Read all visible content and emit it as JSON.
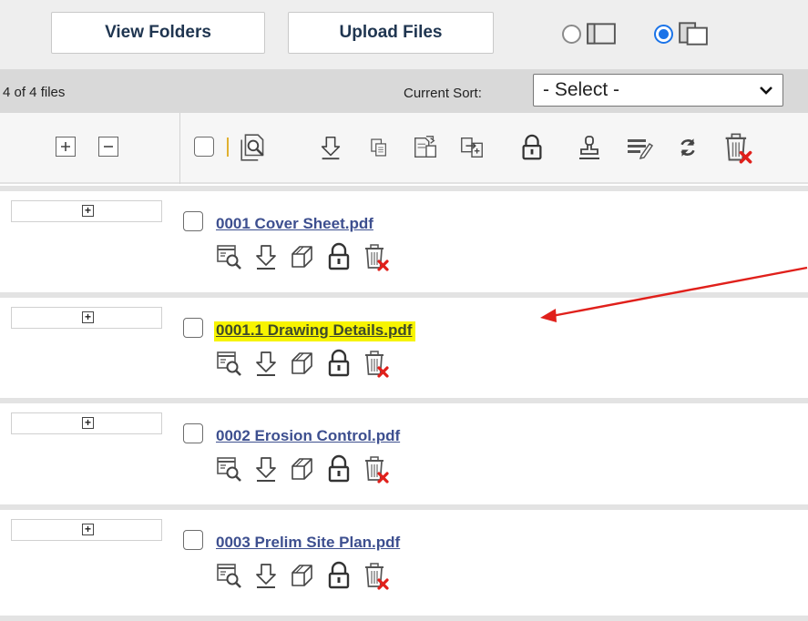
{
  "topbar": {
    "view_folders_label": "View Folders",
    "upload_files_label": "Upload Files",
    "view_modes": [
      {
        "icon": "single-pane-layout-icon",
        "selected": false
      },
      {
        "icon": "stacked-pane-layout-icon",
        "selected": true
      }
    ]
  },
  "infobar": {
    "file_count": "4 of 4 files",
    "sort_label": "Current Sort:",
    "sort_value": "- Select -"
  },
  "toolbar": {
    "tree_controls": [
      "expand-all-icon",
      "collapse-all-icon"
    ],
    "bulk_actions": [
      "select-all-checkbox",
      "search-document-icon",
      "download-icon",
      "copy-icon",
      "move-icon",
      "merge-icon",
      "lock-icon",
      "stamp-icon",
      "edit-properties-icon",
      "refresh-icon",
      "delete-icon"
    ]
  },
  "files": [
    {
      "name": "0001 Cover Sheet.pdf",
      "highlighted": false
    },
    {
      "name": "0001.1 Drawing Details.pdf",
      "highlighted": true
    },
    {
      "name": "0002 Erosion Control.pdf",
      "highlighted": false
    },
    {
      "name": "0003 Prelim Site Plan.pdf",
      "highlighted": false
    }
  ],
  "row_actions": [
    "preview-icon",
    "download-icon",
    "copy-icon",
    "lock-icon",
    "delete-icon"
  ],
  "colors": {
    "link": "#3d4f8f",
    "highlight": "#f7f400",
    "annotation_arrow": "#e0201b",
    "radio_selected": "#1a73e8",
    "delete_x": "#e0201b"
  }
}
